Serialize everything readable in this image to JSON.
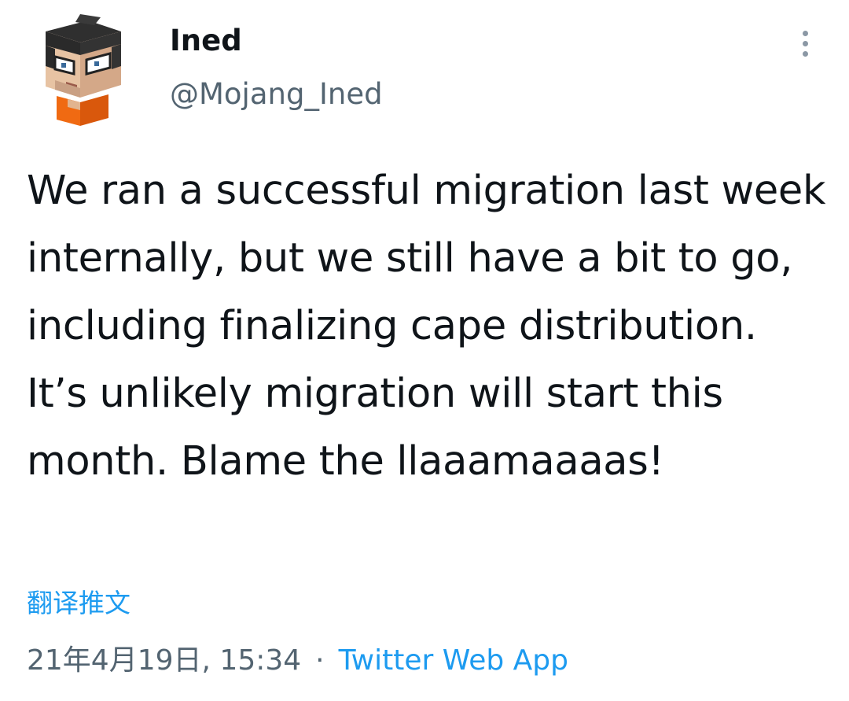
{
  "author": {
    "display_name": "Ined",
    "handle": "@Mojang_Ined",
    "avatar_icon": "pixel-character-avatar"
  },
  "header": {
    "more_icon": "vertical-ellipsis-icon"
  },
  "tweet": {
    "text": "We ran a successful migration last week internally, but we still have a bit to go, including finalizing cape distribution. It’s unlikely migration will start this month. Blame the llaaamaaaas!",
    "translate_label": "翻译推文",
    "timestamp": "21年4月19日, 15:34",
    "separator": "·",
    "source": "Twitter Web App"
  },
  "colors": {
    "text": "#0f1419",
    "muted": "#536471",
    "link": "#1d9bf0"
  }
}
